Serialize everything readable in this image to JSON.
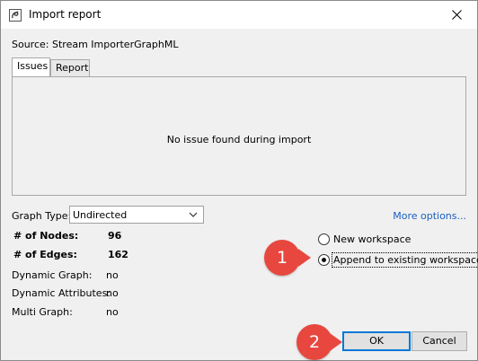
{
  "window": {
    "title": "Import report"
  },
  "source": {
    "label": "Source:",
    "value": "Stream ImporterGraphML"
  },
  "tabs": [
    {
      "label": "Issues",
      "active": true
    },
    {
      "label": "Report",
      "active": false
    }
  ],
  "issues_panel": {
    "message": "No issue found during import"
  },
  "graph_type": {
    "label": "Graph Type:",
    "selected": "Undirected"
  },
  "more_options_label": "More options...",
  "stats": {
    "nodes_label": "# of Nodes:",
    "nodes_value": "96",
    "edges_label": "# of Edges:",
    "edges_value": "162",
    "dynamic_graph_label": "Dynamic Graph:",
    "dynamic_graph_value": "no",
    "dynamic_attributes_label": "Dynamic Attributes:",
    "dynamic_attributes_value": "no",
    "multi_graph_label": "Multi Graph:",
    "multi_graph_value": "no"
  },
  "workspace": {
    "new_label": "New workspace",
    "append_label": "Append to existing workspace",
    "selected": "append"
  },
  "annotations": {
    "badge_1": "1",
    "badge_2": "2",
    "color": "#e8473f"
  },
  "buttons": {
    "ok": "OK",
    "cancel": "Cancel"
  },
  "colors": {
    "link": "#1a5fbf",
    "focus": "#0078d7",
    "dialog_bg": "#f0f0f0"
  }
}
